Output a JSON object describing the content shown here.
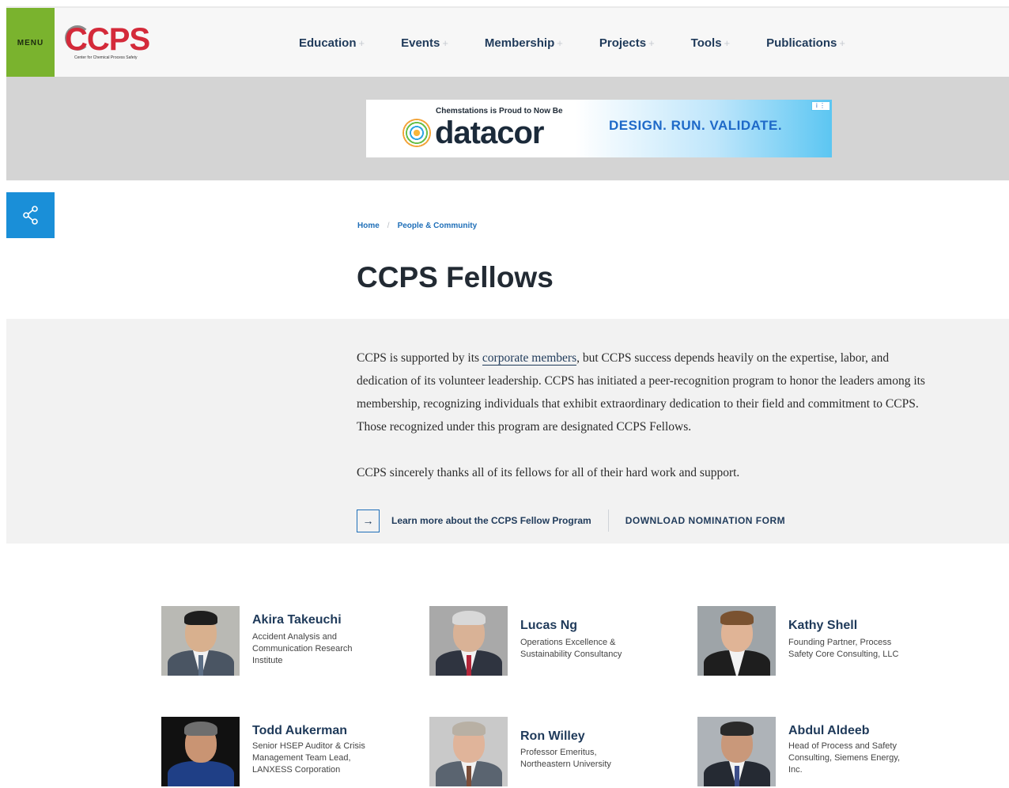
{
  "header": {
    "menu_label": "MENU",
    "logo_text": "CCPS",
    "logo_subtitle": "Center for Chemical Process Safety",
    "nav": [
      {
        "label": "Education"
      },
      {
        "label": "Events"
      },
      {
        "label": "Membership"
      },
      {
        "label": "Projects"
      },
      {
        "label": "Tools"
      },
      {
        "label": "Publications"
      }
    ]
  },
  "ad": {
    "proud_text": "Chemstations is Proud to Now Be",
    "brand": "datacor",
    "tagline": "DESIGN. RUN. VALIDATE."
  },
  "breadcrumb": {
    "home": "Home",
    "current": "People & Community"
  },
  "page": {
    "title": "CCPS Fellows"
  },
  "intro": {
    "p1_before_link": "CCPS is supported by its ",
    "p1_link": "corporate members",
    "p1_after_link": ", but CCPS success depends heavily on the expertise, labor, and dedication of its volunteer leadership. CCPS has initiated a peer-recognition program to honor the leaders among its membership, recognizing individuals that exhibit extraordinary dedication to their field and commitment to CCPS. Those recognized under this program are designated CCPS Fellows.",
    "p2": "CCPS sincerely thanks all of its fellows for all of their hard work and support.",
    "learn_more": "Learn more about the CCPS Fellow Program",
    "download": "DOWNLOAD NOMINATION FORM"
  },
  "fellows": [
    {
      "name": "Akira Takeuchi",
      "org": "Accident Analysis and Communication Research Institute"
    },
    {
      "name": "Lucas Ng",
      "org": "Operations Excellence & Sustainability Consultancy"
    },
    {
      "name": "Kathy Shell",
      "org": "Founding Partner, Process Safety Core Consulting, LLC"
    },
    {
      "name": "Todd Aukerman",
      "org": "Senior HSEP Auditor & Crisis Management Team Lead, LANXESS Corporation"
    },
    {
      "name": "Ron Willey",
      "org": "Professor Emeritus, Northeastern University"
    },
    {
      "name": "Abdul Aldeeb",
      "org": "Head of Process and Safety Consulting, Siemens Energy, Inc."
    }
  ],
  "colors": {
    "menu_green": "#7ab32e",
    "nav_text": "#1f3a5a",
    "share_blue": "#1a8fd8",
    "logo_red": "#d42a3a"
  }
}
